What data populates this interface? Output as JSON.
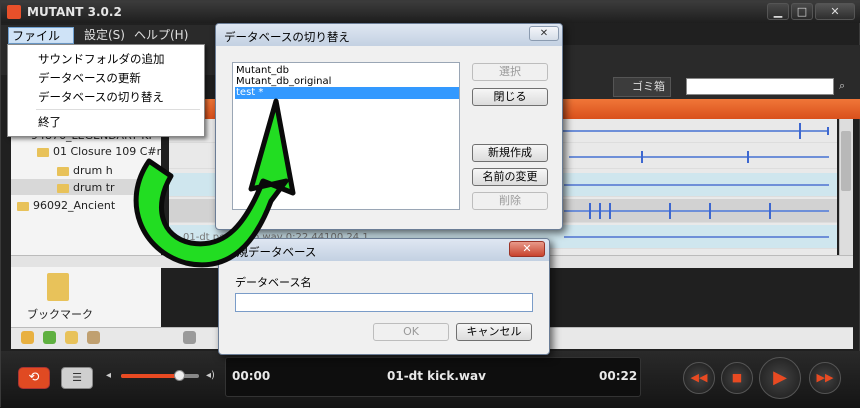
{
  "window": {
    "title": "MUTANT 3.0.2",
    "min": "▁",
    "max": "□",
    "close": "✕"
  },
  "menubar": {
    "file": "ファイル(F)",
    "settings": "設定(S)",
    "help": "ヘルプ(H)"
  },
  "file_menu": {
    "items": [
      "サウンドフォルダの追加",
      "データベースの更新",
      "データベースの切り替え",
      "終了"
    ]
  },
  "tabs": {
    "trash": "ゴミ箱"
  },
  "tree": {
    "items": [
      "94876_LEGENDARY KI",
      "01 Closure 109 C#m",
      "drum h",
      "drum tr",
      "96092_Ancient"
    ]
  },
  "list": {
    "partial_row": "01-dt perc loop.wav    0:22    44100    24    1"
  },
  "bookmark": {
    "label": "ブックマーク"
  },
  "player": {
    "time_start": "00:00",
    "track": "01-dt kick.wav",
    "time_end": "00:22",
    "volume": 0.74
  },
  "db_dialog": {
    "title": "データベースの切り替え",
    "close": "✕",
    "databases": [
      "Mutant_db",
      "Mutant_db_original",
      "test *"
    ],
    "buttons": {
      "select": "選択",
      "close": "閉じる",
      "new": "新規作成",
      "rename": "名前の変更",
      "delete": "削除"
    }
  },
  "new_db_dialog": {
    "title": "新規データベース",
    "close": "✕",
    "label": "データベース名",
    "input_value": "",
    "ok": "OK",
    "cancel": "キャンセル"
  },
  "colors": {
    "accent": "#e84a22",
    "arrow": "#22dd22",
    "selection": "#3399ff"
  }
}
